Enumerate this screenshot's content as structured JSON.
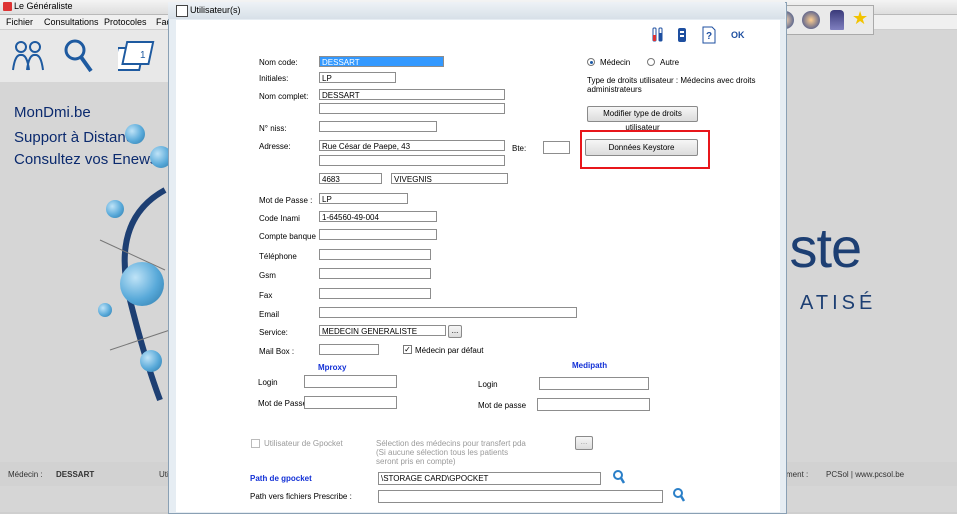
{
  "app": {
    "title": "Le Généraliste",
    "menu": [
      "Fichier",
      "Consultations",
      "Protocoles",
      "Fac"
    ],
    "links": [
      "MonDmi.be",
      "Support à Distance",
      "Consultez vos Enews"
    ],
    "brand_big": "iste",
    "brand_small": "ATISÉ",
    "status": {
      "medecin_label": "Médecin :",
      "medecin_value": "DESSART",
      "left_partial": "Uti",
      "right_partial": "ment :",
      "company": "PCSol | www.pcsol.be"
    }
  },
  "dialog": {
    "title": "Utilisateur(s)",
    "toolbar_icons": [
      "tubes-icon",
      "battery-icon",
      "help-icon",
      "ok-icon"
    ],
    "ok_label": "OK",
    "form": {
      "nom_code": {
        "label": "Nom code:",
        "value": "DESSART"
      },
      "initiales": {
        "label": "Initiales:",
        "value": "LP"
      },
      "nom_complet": {
        "label": "Nom complet:",
        "value": "DESSART",
        "value2": ""
      },
      "niss": {
        "label": "N° niss:",
        "value": ""
      },
      "adresse": {
        "label": "Adresse:",
        "line1": "Rue César de Paepe, 43",
        "line2": "",
        "postcode": "4683",
        "city": "VIVEGNIS"
      },
      "bte": {
        "label": "Bte:",
        "value": ""
      },
      "mot_de_passe": {
        "label": "Mot de Passe :",
        "value": "LP"
      },
      "code_inami": {
        "label": "Code Inami",
        "value": "1-64560-49-004"
      },
      "compte_banque": {
        "label": "Compte banque",
        "value": ""
      },
      "telephone": {
        "label": "Téléphone",
        "value": ""
      },
      "gsm": {
        "label": "Gsm",
        "value": ""
      },
      "fax": {
        "label": "Fax",
        "value": ""
      },
      "email": {
        "label": "Email",
        "value": ""
      },
      "service": {
        "label": "Service:",
        "value": "MEDECIN GENERALISTE",
        "browse": "..."
      },
      "mailbox": {
        "label": "Mail Box :",
        "value": ""
      },
      "medecin_defaut": {
        "label": "Médecin par défaut",
        "checked": true
      }
    },
    "right": {
      "radio_medecin": "Médecin",
      "radio_autre": "Autre",
      "rights_text_1": "Type de droits utilisateur : Médecins avec droits",
      "rights_text_2": "administrateurs",
      "modify_button": "Modifier type de droits utilisateur",
      "keystore_button": "Données Keystore"
    },
    "mproxy": {
      "title": "Mproxy",
      "login_label": "Login",
      "login_value": "",
      "pass_label": "Mot de Passe",
      "pass_value": ""
    },
    "medipath": {
      "title": "Medipath",
      "login_label": "Login",
      "login_value": "",
      "pass_label": "Mot de passe",
      "pass_value": ""
    },
    "gpocket": {
      "user_label": "Utilisateur de Gpocket",
      "selection_1": "Sélection des médecins pour transfert pda",
      "selection_2": "(Si aucune sélection tous les patients",
      "selection_3": "seront pris en compte)",
      "browse": "...",
      "path_label": "Path de gpocket",
      "path_value": "\\STORAGE CARD\\GPOCKET",
      "prescribe_label": "Path vers fichiers Prescribe :",
      "prescribe_value": ""
    }
  },
  "colors": {
    "accent_blue": "#1230d6",
    "highlight_red": "#e8161b",
    "selection": "#3399ff"
  }
}
